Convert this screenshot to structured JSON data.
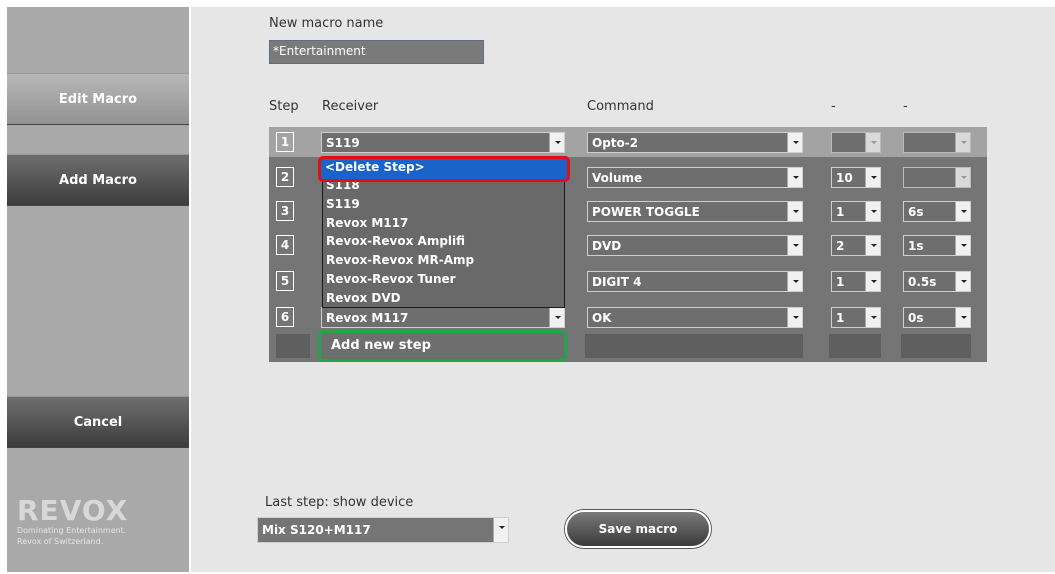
{
  "sidebar": {
    "edit_macro": "Edit Macro",
    "add_macro": "Add Macro",
    "cancel": "Cancel",
    "logo_word": "REVOX",
    "logo_tagline_1": "Dominating Entertainment.",
    "logo_tagline_2": "Revox of Switzerland."
  },
  "form": {
    "name_label": "New macro name",
    "name_value": "*Entertainment"
  },
  "table": {
    "headers": {
      "step": "Step",
      "receiver": "Receiver",
      "command": "Command",
      "col4": "-",
      "col5": "-"
    },
    "rows": [
      {
        "step": "1",
        "receiver": "S119",
        "command": "Opto-2",
        "col4": "",
        "col5": ""
      },
      {
        "step": "2",
        "receiver": "",
        "command": "Volume",
        "col4": "10",
        "col5": ""
      },
      {
        "step": "3",
        "receiver": "",
        "command": "POWER TOGGLE",
        "col4": "1",
        "col5": "6s"
      },
      {
        "step": "4",
        "receiver": "",
        "command": "DVD",
        "col4": "2",
        "col5": "1s"
      },
      {
        "step": "5",
        "receiver": "",
        "command": "DIGIT 4",
        "col4": "1",
        "col5": "0.5s"
      },
      {
        "step": "6",
        "receiver": "Revox M117",
        "command": "OK",
        "col4": "1",
        "col5": "0s"
      }
    ],
    "add_step": "Add new step"
  },
  "dropdown": {
    "selected": "<Delete Step>",
    "items": [
      "S118",
      "S119",
      "Revox M117",
      "Revox-Revox Amplifi",
      "Revox-Revox MR-Amp",
      "Revox-Revox Tuner",
      "Revox DVD"
    ]
  },
  "bottom": {
    "last_step_label": "Last step: show device",
    "device_value": "Mix S120+M117",
    "save_label": "Save macro"
  },
  "colors": {
    "add_step_border": "#1fa64a",
    "delete_step_border": "#e01010",
    "selected_bg": "#1a63c8"
  }
}
